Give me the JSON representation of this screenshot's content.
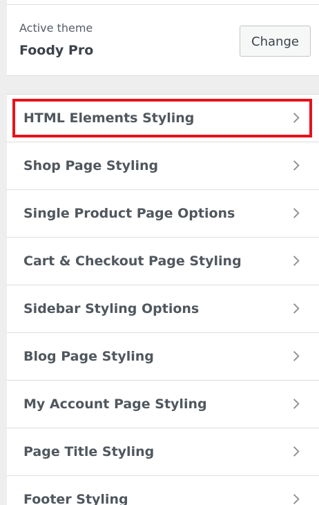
{
  "theme": {
    "active_label": "Active theme",
    "name": "Foody Pro",
    "change_label": "Change"
  },
  "menu": {
    "items": [
      {
        "label": "HTML Elements Styling"
      },
      {
        "label": "Shop Page Styling"
      },
      {
        "label": "Single Product Page Options"
      },
      {
        "label": "Cart & Checkout Page Styling"
      },
      {
        "label": "Sidebar Styling Options"
      },
      {
        "label": "Blog Page Styling"
      },
      {
        "label": "My Account Page Styling"
      },
      {
        "label": "Page Title Styling"
      },
      {
        "label": "Footer Styling"
      }
    ]
  },
  "icons": {
    "menu_chevron": "chevron-right-icon"
  },
  "colors": {
    "highlight": "#e5131b",
    "label": "#50575e",
    "background": "#eeeeee"
  }
}
